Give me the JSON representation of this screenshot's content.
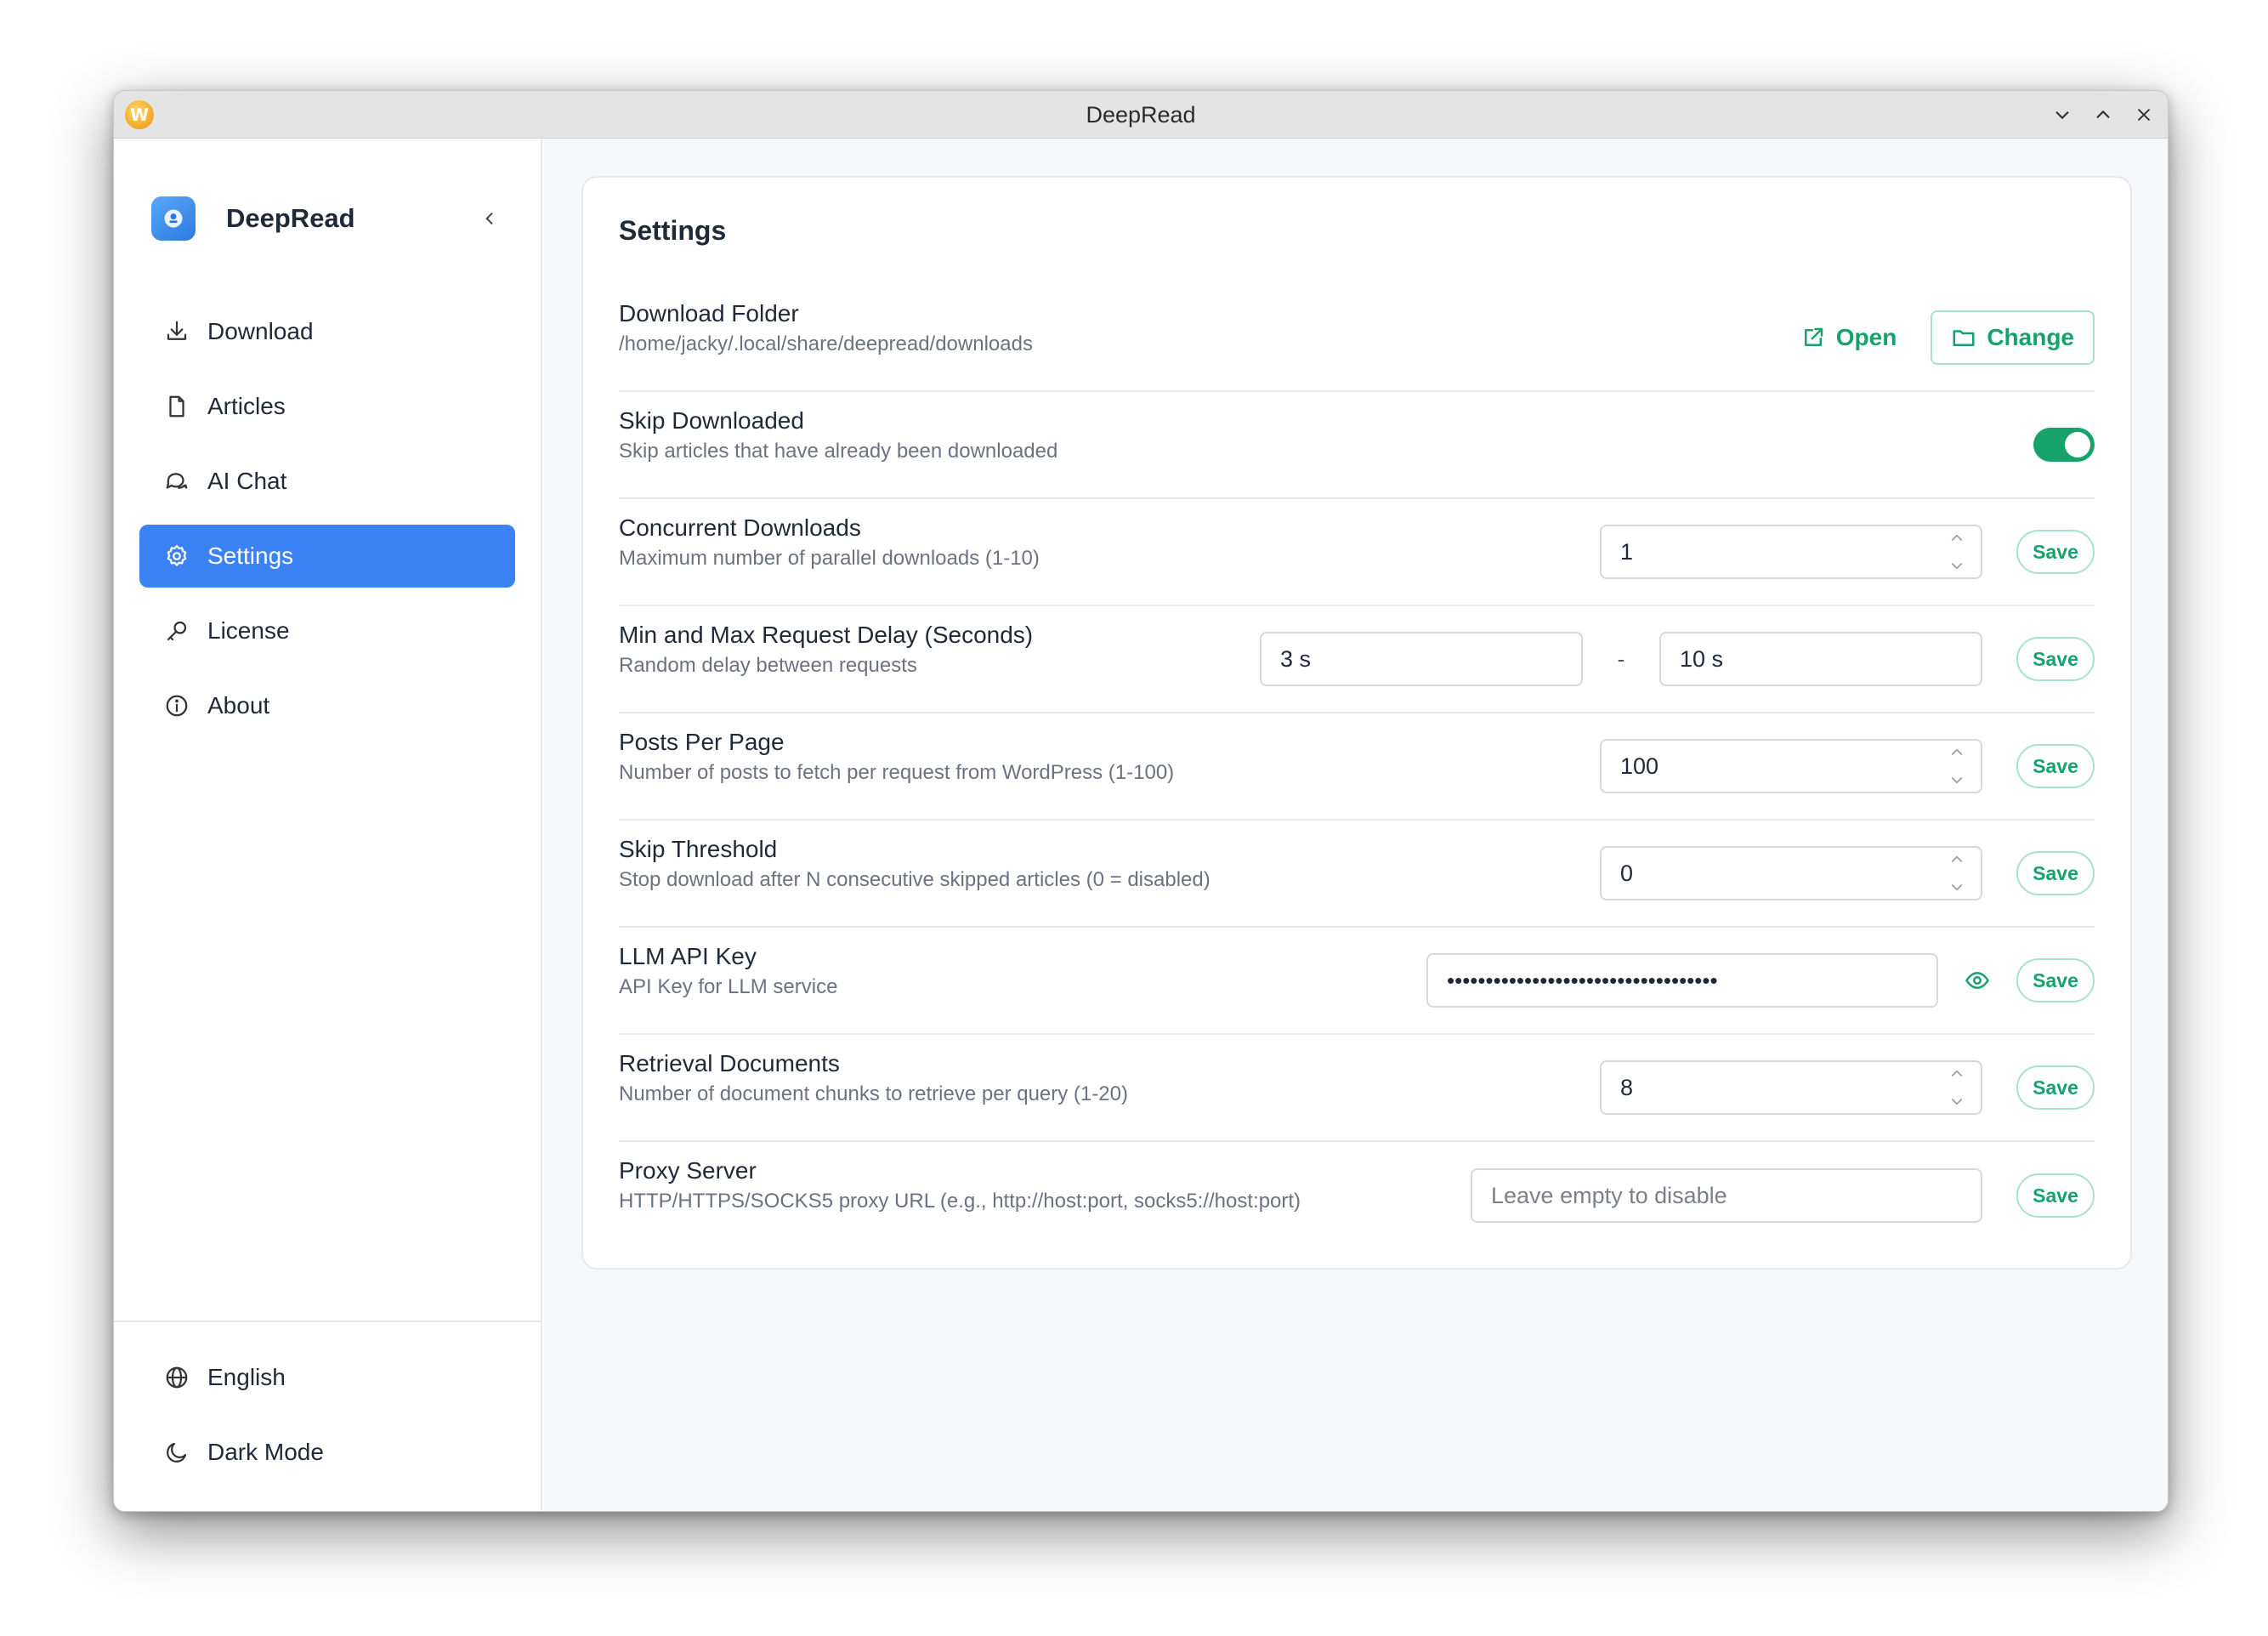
{
  "window": {
    "title": "DeepRead"
  },
  "sidebar": {
    "brand": "DeepRead",
    "items": [
      {
        "label": "Download",
        "icon": "download-icon",
        "active": false
      },
      {
        "label": "Articles",
        "icon": "file-icon",
        "active": false
      },
      {
        "label": "AI Chat",
        "icon": "chat-icon",
        "active": false
      },
      {
        "label": "Settings",
        "icon": "gear-icon",
        "active": true
      },
      {
        "label": "License",
        "icon": "key-icon",
        "active": false
      },
      {
        "label": "About",
        "icon": "info-icon",
        "active": false
      }
    ],
    "bottom": [
      {
        "label": "English",
        "icon": "globe-icon"
      },
      {
        "label": "Dark Mode",
        "icon": "moon-icon"
      }
    ]
  },
  "settings": {
    "title": "Settings",
    "save_label": "Save",
    "download_folder": {
      "label": "Download Folder",
      "desc": "/home/jacky/.local/share/deepread/downloads",
      "open_label": "Open",
      "change_label": "Change"
    },
    "skip_downloaded": {
      "label": "Skip Downloaded",
      "desc": "Skip articles that have already been downloaded",
      "enabled": true
    },
    "concurrent_downloads": {
      "label": "Concurrent Downloads",
      "desc": "Maximum number of parallel downloads (1-10)",
      "value": "1"
    },
    "request_delay": {
      "label": "Min and Max Request Delay (Seconds)",
      "desc": "Random delay between requests",
      "min": "3 s",
      "separator": "-",
      "max": "10 s"
    },
    "posts_per_page": {
      "label": "Posts Per Page",
      "desc": "Number of posts to fetch per request from WordPress (1-100)",
      "value": "100"
    },
    "skip_threshold": {
      "label": "Skip Threshold",
      "desc": "Stop download after N consecutive skipped articles (0 = disabled)",
      "value": "0"
    },
    "llm_api_key": {
      "label": "LLM API Key",
      "desc": "API Key for LLM service",
      "masked_value": "•••••••••••••••••••••••••••••••••••"
    },
    "retrieval_documents": {
      "label": "Retrieval Documents",
      "desc": "Number of document chunks to retrieve per query (1-20)",
      "value": "8"
    },
    "proxy_server": {
      "label": "Proxy Server",
      "desc": "HTTP/HTTPS/SOCKS5 proxy URL (e.g., http://host:port, socks5://host:port)",
      "placeholder": "Leave empty to disable"
    }
  },
  "colors": {
    "accent_blue": "#3b82f6",
    "accent_green": "#16a36b",
    "border": "#e6e8ec"
  }
}
